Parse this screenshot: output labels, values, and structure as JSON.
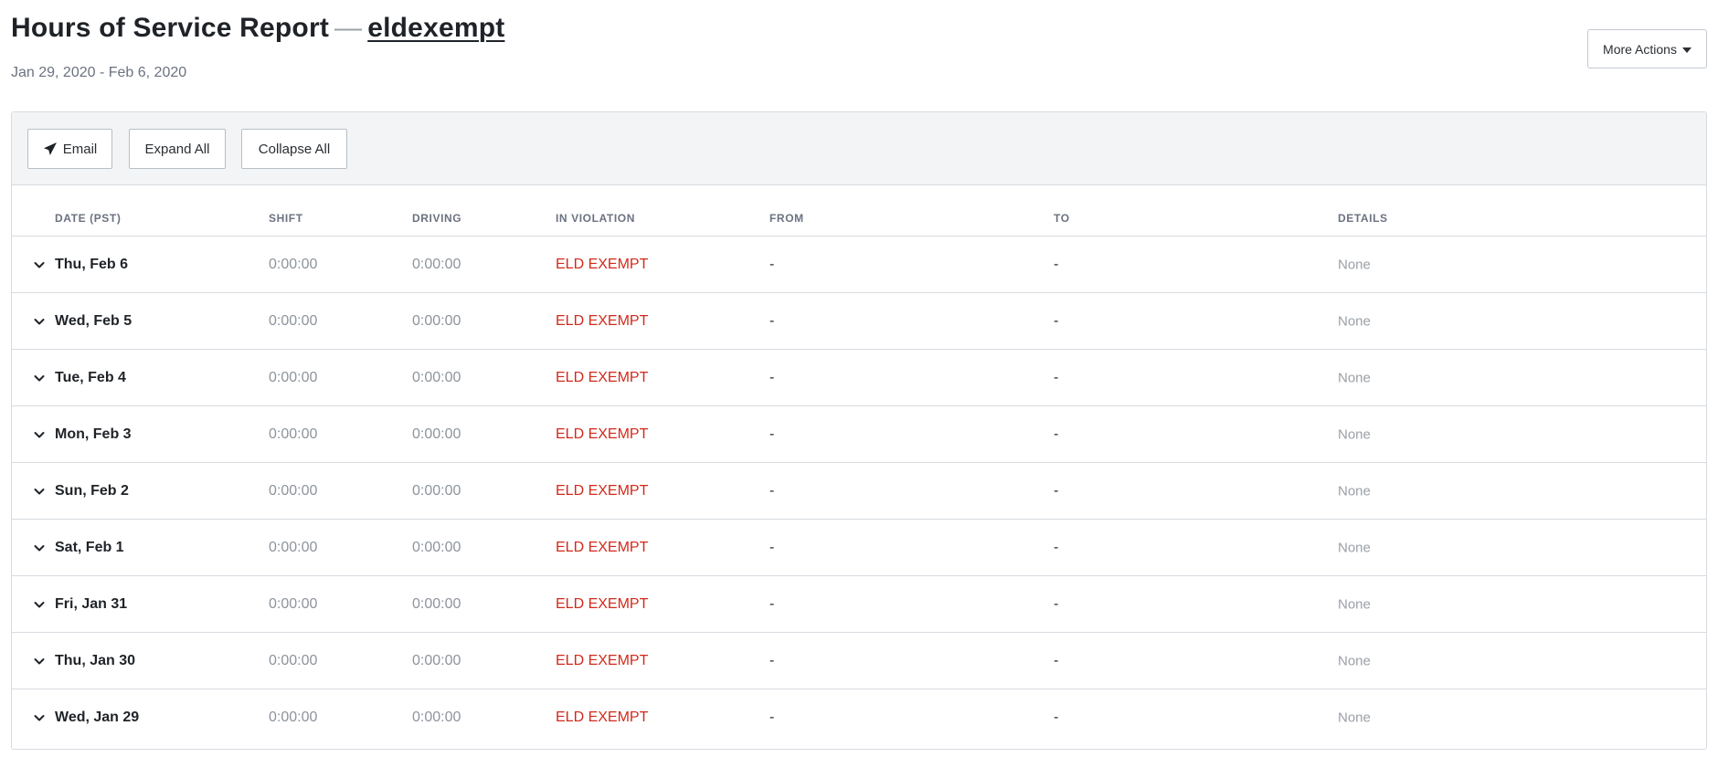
{
  "header": {
    "title": "Hours of Service Report",
    "separator": "—",
    "driver": "eldexempt",
    "date_range": "Jan 29, 2020 - Feb 6, 2020"
  },
  "actions": {
    "more_actions_label": "More Actions"
  },
  "toolbar": {
    "email_label": "Email",
    "expand_label": "Expand All",
    "collapse_label": "Collapse All"
  },
  "columns": [
    "DATE (PST)",
    "SHIFT",
    "DRIVING",
    "IN VIOLATION",
    "FROM",
    "TO",
    "DETAILS"
  ],
  "rows": [
    {
      "date": "Thu, Feb 6",
      "shift": "0:00:00",
      "driving": "0:00:00",
      "violation": "ELD EXEMPT",
      "from": "-",
      "to": "-",
      "details": "None"
    },
    {
      "date": "Wed, Feb 5",
      "shift": "0:00:00",
      "driving": "0:00:00",
      "violation": "ELD EXEMPT",
      "from": "-",
      "to": "-",
      "details": "None"
    },
    {
      "date": "Tue, Feb 4",
      "shift": "0:00:00",
      "driving": "0:00:00",
      "violation": "ELD EXEMPT",
      "from": "-",
      "to": "-",
      "details": "None"
    },
    {
      "date": "Mon, Feb 3",
      "shift": "0:00:00",
      "driving": "0:00:00",
      "violation": "ELD EXEMPT",
      "from": "-",
      "to": "-",
      "details": "None"
    },
    {
      "date": "Sun, Feb 2",
      "shift": "0:00:00",
      "driving": "0:00:00",
      "violation": "ELD EXEMPT",
      "from": "-",
      "to": "-",
      "details": "None"
    },
    {
      "date": "Sat, Feb 1",
      "shift": "0:00:00",
      "driving": "0:00:00",
      "violation": "ELD EXEMPT",
      "from": "-",
      "to": "-",
      "details": "None"
    },
    {
      "date": "Fri, Jan 31",
      "shift": "0:00:00",
      "driving": "0:00:00",
      "violation": "ELD EXEMPT",
      "from": "-",
      "to": "-",
      "details": "None"
    },
    {
      "date": "Thu, Jan 30",
      "shift": "0:00:00",
      "driving": "0:00:00",
      "violation": "ELD EXEMPT",
      "from": "-",
      "to": "-",
      "details": "None"
    },
    {
      "date": "Wed, Jan 29",
      "shift": "0:00:00",
      "driving": "0:00:00",
      "violation": "ELD EXEMPT",
      "from": "-",
      "to": "-",
      "details": "None"
    }
  ],
  "icons": {
    "email": "paper-plane-icon",
    "row_toggle": "chevron-down-icon",
    "menu": "caret-down-icon"
  },
  "colors": {
    "violation": "#d12a1b",
    "muted": "#8d949c",
    "toolbar_bg": "#f3f4f5",
    "border": "#d7dbe0"
  }
}
